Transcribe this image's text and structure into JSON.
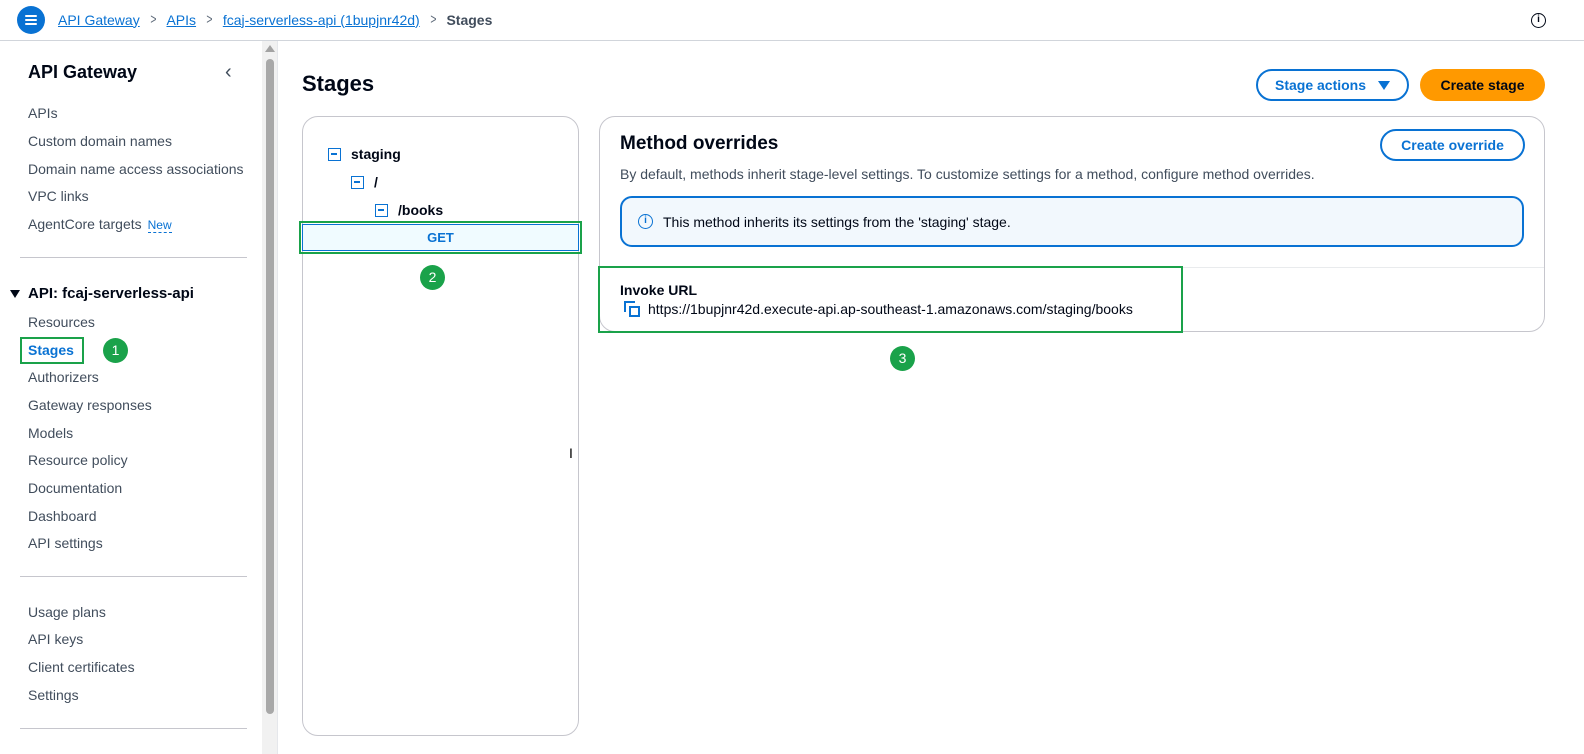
{
  "breadcrumb": {
    "items": [
      "API Gateway",
      "APIs",
      "fcaj-serverless-api (1bupjnr42d)"
    ],
    "current": "Stages"
  },
  "sidebar": {
    "title": "API Gateway",
    "top_items": [
      "APIs",
      "Custom domain names",
      "Domain name access associations",
      "VPC links",
      "AgentCore targets"
    ],
    "new_badge": "New",
    "api_section": "API: fcaj-serverless-api",
    "api_items": [
      "Resources",
      "Stages",
      "Authorizers",
      "Gateway responses",
      "Models",
      "Resource policy",
      "Documentation",
      "Dashboard",
      "API settings"
    ],
    "bottom_items": [
      "Usage plans",
      "API keys",
      "Client certificates",
      "Settings"
    ]
  },
  "steps": [
    "1",
    "2",
    "3"
  ],
  "main": {
    "title": "Stages",
    "stage_actions_label": "Stage actions",
    "create_stage_label": "Create stage"
  },
  "tree": {
    "stage": "staging",
    "root": "/",
    "resource": "/books",
    "method": "GET"
  },
  "detail": {
    "title": "Method overrides",
    "create_override_label": "Create override",
    "description": "By default, methods inherit stage-level settings. To customize settings for a method, configure method overrides.",
    "alert": "This method inherits its settings from the 'staging' stage.",
    "invoke_label": "Invoke URL",
    "invoke_url": "https://1bupjnr42d.execute-api.ap-southeast-1.amazonaws.com/staging/books"
  },
  "colors": {
    "accent": "#0972d3",
    "primary_button": "#ff9900",
    "highlight": "#1aa24a"
  }
}
